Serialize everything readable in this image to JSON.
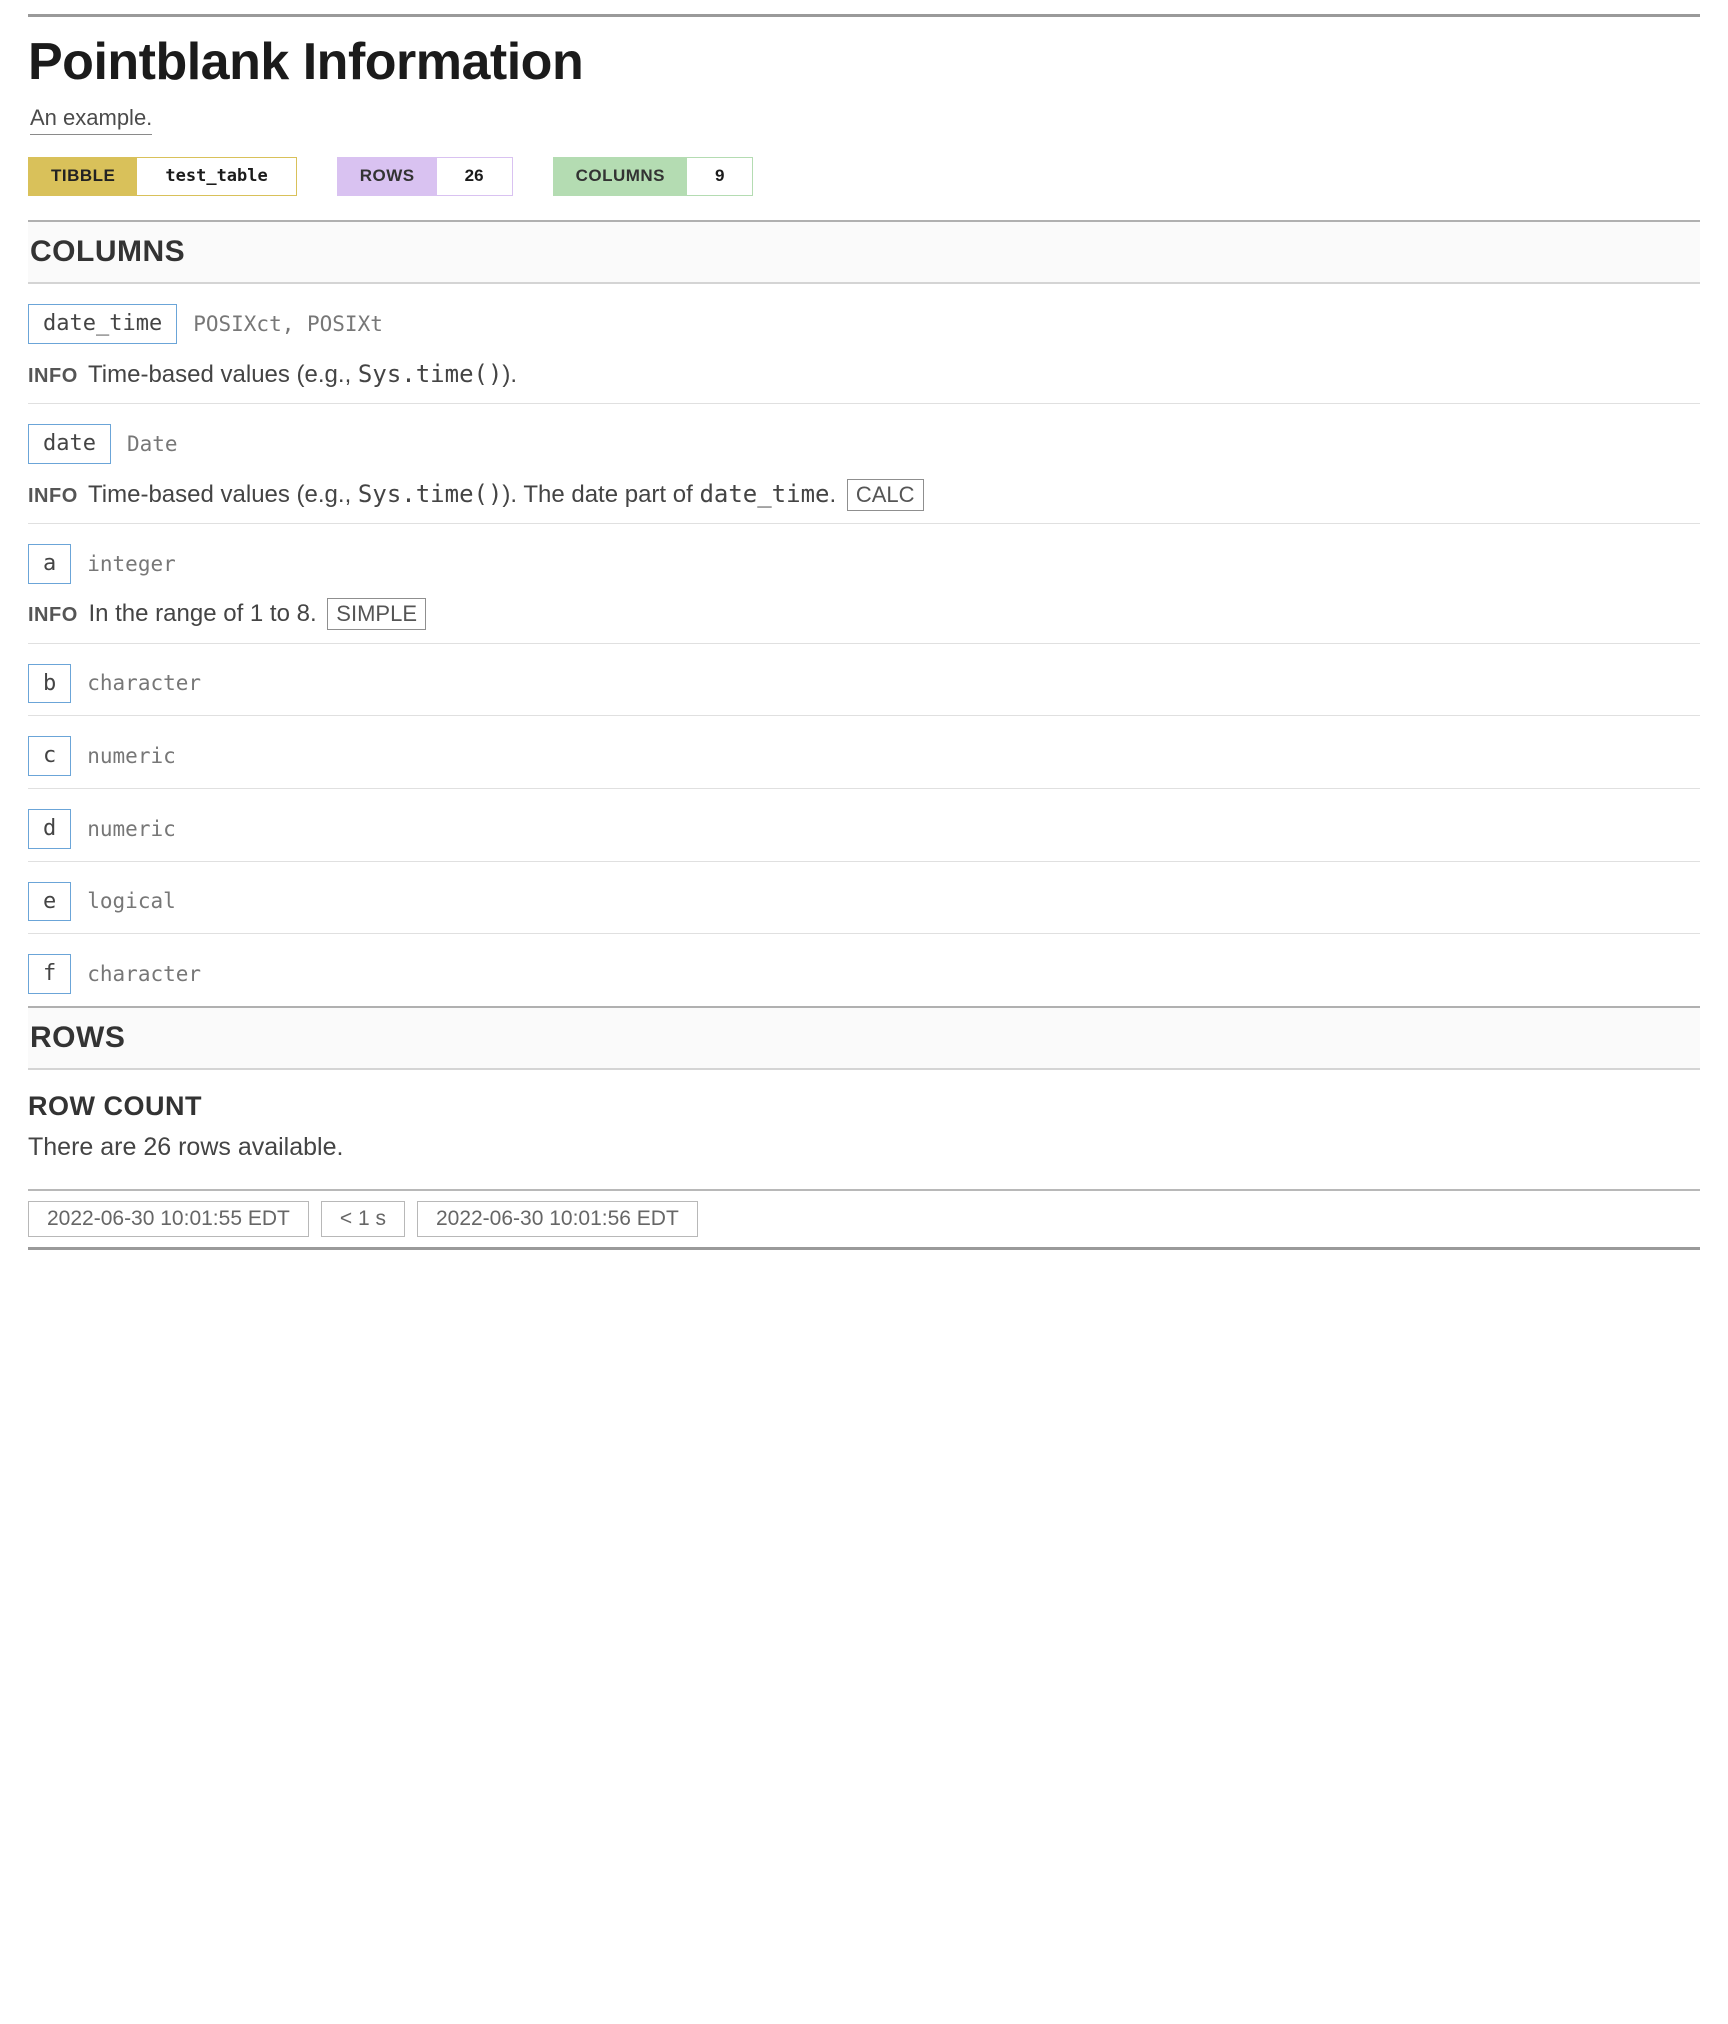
{
  "header": {
    "title": "Pointblank Information",
    "subtitle": "An example."
  },
  "badges": {
    "tibble_label": "TIBBLE",
    "tibble_value": "test_table",
    "rows_label": "ROWS",
    "rows_value": "26",
    "cols_label": "COLUMNS",
    "cols_value": "9"
  },
  "sections": {
    "columns_heading": "COLUMNS",
    "rows_heading": "ROWS"
  },
  "columns": [
    {
      "name": "date_time",
      "type": "POSIXct, POSIXt",
      "info_label": "INFO",
      "info_pre": "Time-based values (e.g., ",
      "info_code": "Sys.time()",
      "info_post": ").",
      "tag": null
    },
    {
      "name": "date",
      "type": "Date",
      "info_label": "INFO",
      "info_pre": "Time-based values (e.g., ",
      "info_code": "Sys.time()",
      "info_post": "). The date part of ",
      "info_code2": "date_time",
      "info_post2": ".",
      "tag": "CALC"
    },
    {
      "name": "a",
      "type": "integer",
      "info_label": "INFO",
      "info_plain": "In the range of 1 to 8.",
      "tag": "SIMPLE"
    },
    {
      "name": "b",
      "type": "character"
    },
    {
      "name": "c",
      "type": "numeric"
    },
    {
      "name": "d",
      "type": "numeric"
    },
    {
      "name": "e",
      "type": "logical"
    },
    {
      "name": "f",
      "type": "character"
    }
  ],
  "rows_section": {
    "row_count_label": "ROW COUNT",
    "row_count_text": "There are 26 rows available."
  },
  "footer": {
    "start": "2022-06-30 10:01:55 EDT",
    "duration": "< 1 s",
    "end": "2022-06-30 10:01:56 EDT"
  }
}
